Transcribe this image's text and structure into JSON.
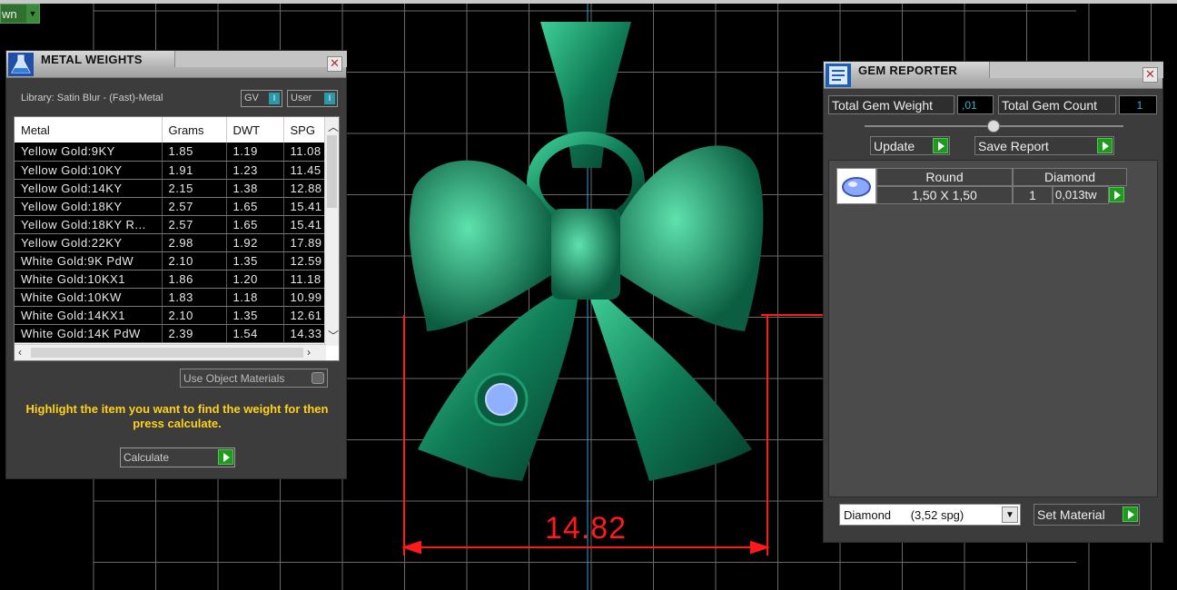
{
  "top_combo": {
    "label": "wn"
  },
  "viewport": {
    "dimension_label": "14.82"
  },
  "metal_weights": {
    "title": "METAL WEIGHTS",
    "library_label": "Library: Satin Blur - (Fast)-Metal",
    "gv_label": "GV",
    "user_label": "User",
    "columns": [
      "Metal",
      "Grams",
      "DWT",
      "SPG"
    ],
    "rows": [
      [
        "Yellow Gold:9KY",
        "1.85",
        "1.19",
        "11.08"
      ],
      [
        "Yellow Gold:10KY",
        "1.91",
        "1.23",
        "11.45"
      ],
      [
        "Yellow Gold:14KY",
        "2.15",
        "1.38",
        "12.88"
      ],
      [
        "Yellow Gold:18KY",
        "2.57",
        "1.65",
        "15.41"
      ],
      [
        "Yellow Gold:18KY R...",
        "2.57",
        "1.65",
        "15.41"
      ],
      [
        "Yellow Gold:22KY",
        "2.98",
        "1.92",
        "17.89"
      ],
      [
        "White Gold:9K PdW",
        "2.10",
        "1.35",
        "12.59"
      ],
      [
        "White Gold:10KX1",
        "1.86",
        "1.20",
        "11.18"
      ],
      [
        "White Gold:10KW",
        "1.83",
        "1.18",
        "10.99"
      ],
      [
        "White Gold:14KX1",
        "2.10",
        "1.35",
        "12.61"
      ],
      [
        "White Gold:14K PdW",
        "2.39",
        "1.54",
        "14.33"
      ]
    ],
    "use_object_materials_label": "Use Object Materials",
    "hint": "Highlight the item you want to find the weight for then press calculate.",
    "calculate_label": "Calculate"
  },
  "gem_reporter": {
    "title": "GEM REPORTER",
    "total_weight_label": "Total Gem Weight",
    "total_weight_value": ",01",
    "total_count_label": "Total Gem Count",
    "total_count_value": "1",
    "update_label": "Update",
    "save_report_label": "Save Report",
    "gem": {
      "shape": "Round",
      "material": "Diamond",
      "size": "1,50 X 1,50",
      "count": "1",
      "weight": "0,013tw"
    },
    "material_select": "Diamond      (3,52 spg)",
    "set_material_label": "Set Material"
  },
  "colors": {
    "pendant": "#0f7a55",
    "dimension": "#ff1a1a",
    "hint_text": "#ffd21a",
    "value_text": "#2bb7d0",
    "accent_button": "#1e9a1e"
  }
}
